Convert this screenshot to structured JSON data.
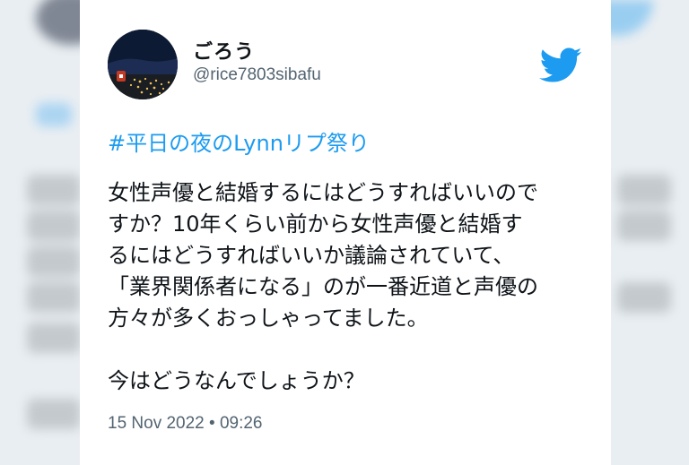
{
  "tweet": {
    "display_name": "ごろう",
    "handle": "@rice7803sibafu",
    "hashtag": "#平日の夜のLynnリプ祭り",
    "lines": [
      "女性声優と結婚するにはどうすればいいので",
      "すか？10年くらい前から女性声優と結婚す",
      "るにはどうすればいいか議論されていて、",
      "「業界関係者になる」のが一番近道と声優の",
      "方々が多くおっしゃってました。"
    ],
    "last_line": "今はどうなんでしょうか？",
    "timestamp": "15 Nov 2022 • 09:26"
  },
  "colors": {
    "accent": "#1d9bf0",
    "text": "#0f1419",
    "muted": "#536471",
    "card_bg": "#ffffff"
  },
  "icons": {
    "logo": "twitter-bird-icon",
    "avatar": "night-city-avatar"
  }
}
